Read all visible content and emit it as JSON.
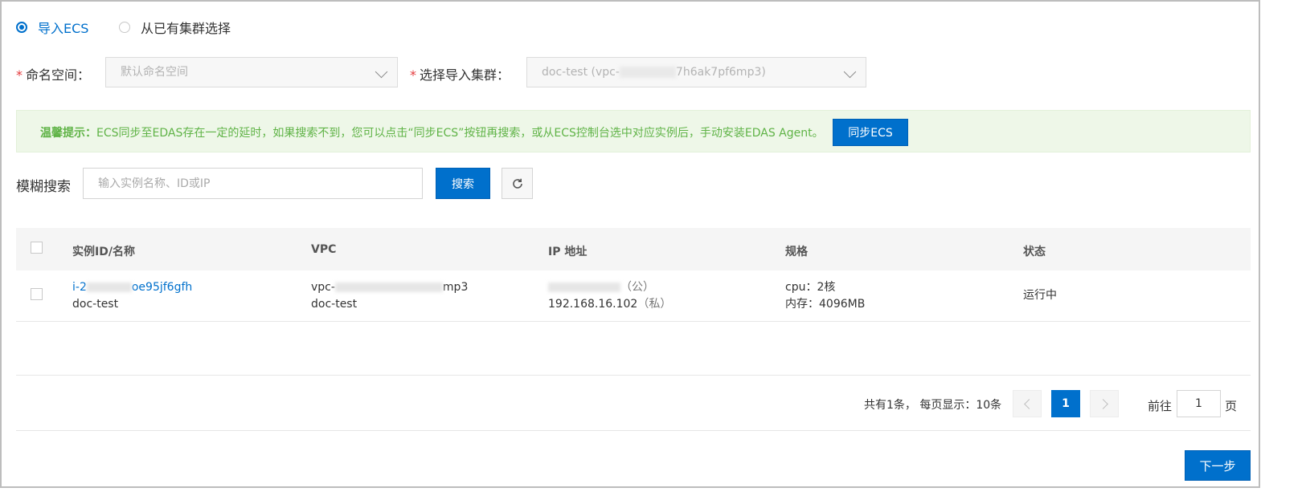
{
  "source_options": {
    "import_ecs": "导入ECS",
    "from_cluster": "从已有集群选择"
  },
  "form": {
    "namespace_label": "命名空间：",
    "namespace_value": "默认命名空间",
    "cluster_label": "选择导入集群：",
    "cluster_value_prefix": "doc-test (vpc-",
    "cluster_value_suffix": "7h6ak7pf6mp3)"
  },
  "tip": {
    "title": "温馨提示：",
    "text": "ECS同步至EDAS存在一定的延时，如果搜索不到，您可以点击“同步ECS”按钮再搜索，或从ECS控制台选中对应实例后，手动安装EDAS Agent。",
    "sync_button": "同步ECS"
  },
  "search": {
    "label": "模糊搜索",
    "placeholder": "输入实例名称、ID或IP",
    "button": "搜索",
    "refresh_icon": "refresh-icon"
  },
  "table": {
    "headers": {
      "id_name": "实例ID/名称",
      "vpc": "VPC",
      "ip": "IP 地址",
      "spec": "规格",
      "status": "状态"
    },
    "rows": [
      {
        "id_prefix": "i-2",
        "id_suffix": "oe95jf6gfh",
        "name": "doc-test",
        "vpc_prefix": "vpc-",
        "vpc_suffix": "mp3",
        "vpc_name": "doc-test",
        "public_tag": "（公）",
        "private_ip": "192.168.16.102",
        "private_tag": "（私）",
        "cpu": "cpu：2核",
        "memory": "内存：4096MB",
        "status": "运行中"
      }
    ]
  },
  "pagination": {
    "summary": "共有1条， 每页显示：10条",
    "current_page": "1",
    "goto_label": "前往",
    "goto_value": "1",
    "page_unit": "页"
  },
  "footer": {
    "next_button": "下一步"
  },
  "colors": {
    "accent": "#0070cc",
    "tip_text": "#5fb346",
    "tip_bg": "#eef7e8",
    "required": "#e4393c"
  }
}
